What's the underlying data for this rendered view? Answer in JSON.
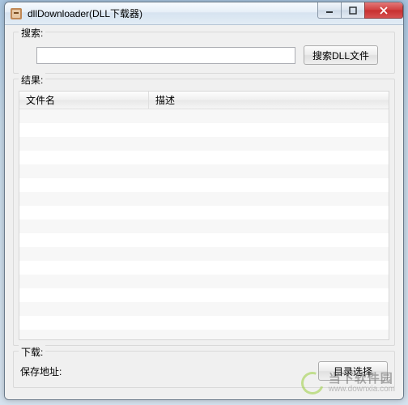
{
  "window": {
    "title": "dllDownloader(DLL下载器)"
  },
  "search": {
    "legend": "搜索:",
    "value": "",
    "button": "搜索DLL文件"
  },
  "results": {
    "legend": "结果:",
    "columns": {
      "filename": "文件名",
      "description": "描述"
    },
    "rows": []
  },
  "download": {
    "legend": "下载:",
    "path_label": "保存地址:",
    "path_value": "",
    "browse_button": "目录选择"
  },
  "watermark": {
    "line1": "当下软件园",
    "line2": "www.downxia.com"
  },
  "icons": {
    "app": "app-icon",
    "minimize": "minimize-icon",
    "maximize": "maximize-icon",
    "close": "close-icon"
  }
}
